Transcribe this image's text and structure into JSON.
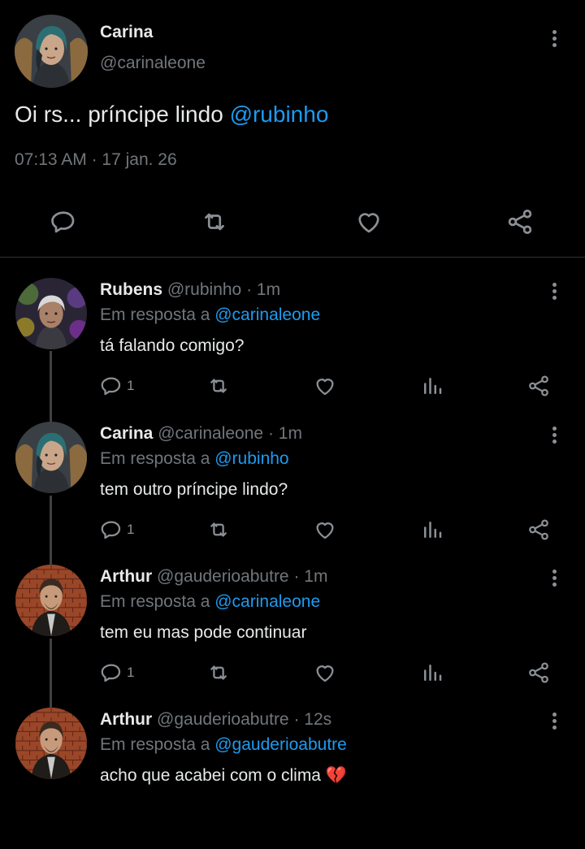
{
  "main_tweet": {
    "author_name": "Carina",
    "author_handle": "@carinaleone",
    "text_plain": "Oi rs... príncipe lindo ",
    "text_mention": "@rubinho",
    "time": "07:13 AM",
    "separator": " · ",
    "date": "17 jan. 26",
    "actions": [
      "reply-icon",
      "retweet-icon",
      "like-icon",
      "share-icon"
    ]
  },
  "replies": [
    {
      "name": "Rubens",
      "handle": "@rubinho",
      "time": "· 1m",
      "reply_prefix": "Em resposta a ",
      "reply_to": "@carinaleone",
      "text": "tá falando comigo?",
      "reply_count": "1"
    },
    {
      "name": "Carina",
      "handle": "@carinaleone",
      "time": "· 1m",
      "reply_prefix": "Em resposta a ",
      "reply_to": "@rubinho",
      "text": "tem outro príncipe lindo?",
      "reply_count": "1"
    },
    {
      "name": "Arthur",
      "handle": "@gauderioabutre",
      "time": "· 1m",
      "reply_prefix": "Em resposta a ",
      "reply_to": "@carinaleone",
      "text": "tem eu mas pode continuar",
      "reply_count": "1"
    },
    {
      "name": "Arthur",
      "handle": "@gauderioabutre",
      "time": "· 12s",
      "reply_prefix": "Em resposta a ",
      "reply_to": "@gauderioabutre",
      "text": "acho que acabei com o clima",
      "emoji": "💔",
      "reply_count": ""
    }
  ],
  "colors": {
    "background": "#000000",
    "text": "#e7e9ea",
    "secondary": "#71767b",
    "mention": "#1d9bf0",
    "thread_line": "#3e4144",
    "divider": "#2f3336"
  }
}
